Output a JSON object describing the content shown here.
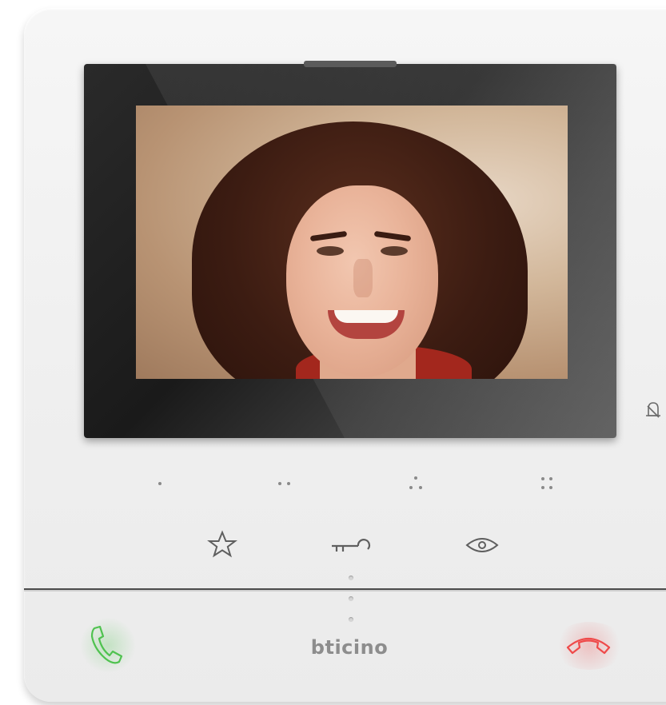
{
  "device": {
    "brand": "bticino",
    "colors": {
      "body": "#f0f0f0",
      "bezel": "#1f1f1f",
      "answer_green": "#4fc24f",
      "hangup_red": "#ef4a4a",
      "icon_gray": "#6a6a6a"
    }
  },
  "screen": {
    "content": "camera-view"
  },
  "indicators": {
    "bell": "bell-icon"
  },
  "dot_keys": [
    {
      "name": "one-dot-key",
      "dots": 1
    },
    {
      "name": "two-dot-key",
      "dots": 2
    },
    {
      "name": "three-dot-key",
      "dots": 3
    },
    {
      "name": "four-dot-key",
      "dots": 4
    }
  ],
  "function_keys": [
    {
      "name": "favorite-button",
      "icon": "star-icon"
    },
    {
      "name": "door-lock-button",
      "icon": "key-icon"
    },
    {
      "name": "camera-cycle-button",
      "icon": "eye-icon"
    }
  ],
  "call_keys": [
    {
      "name": "answer-button",
      "icon": "phone-answer-icon"
    },
    {
      "name": "hang-up-button",
      "icon": "phone-hangup-icon"
    }
  ]
}
